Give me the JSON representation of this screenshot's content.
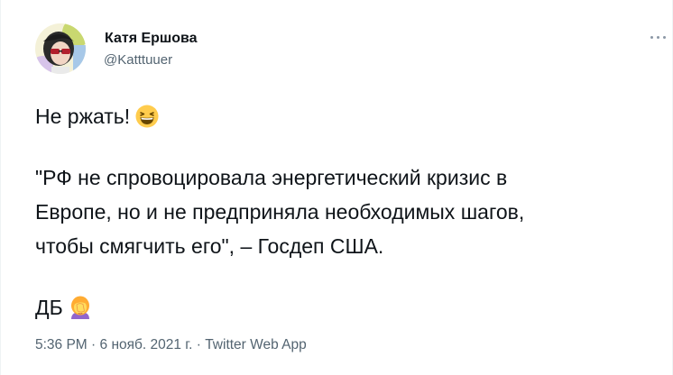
{
  "author": {
    "display_name": "Катя Ершова",
    "username": "@Katttuuer",
    "avatar_icon": "avatar-girl-sunglasses"
  },
  "more_icon": "more-horizontal-icon",
  "tweet": {
    "line1": "Не ржать!",
    "line1_emoji": "grinning-squinting-face",
    "quote_lines": [
      "\"РФ не спровоцировала энергетический кризис в",
      "Европе, но и не предприняла необходимых шагов,",
      "чтобы смягчить его\", – Госдеп США."
    ],
    "sign": "ДБ",
    "sign_emoji": "woman-facepalming"
  },
  "meta": {
    "time": "5:36 PM",
    "sep1": "·",
    "date": "6 нояб. 2021 г.",
    "sep2": "·",
    "source": "Twitter Web App"
  },
  "colors": {
    "text": "#0f1419",
    "secondary": "#536471",
    "emoji_yellow": "#ffcc4d"
  }
}
